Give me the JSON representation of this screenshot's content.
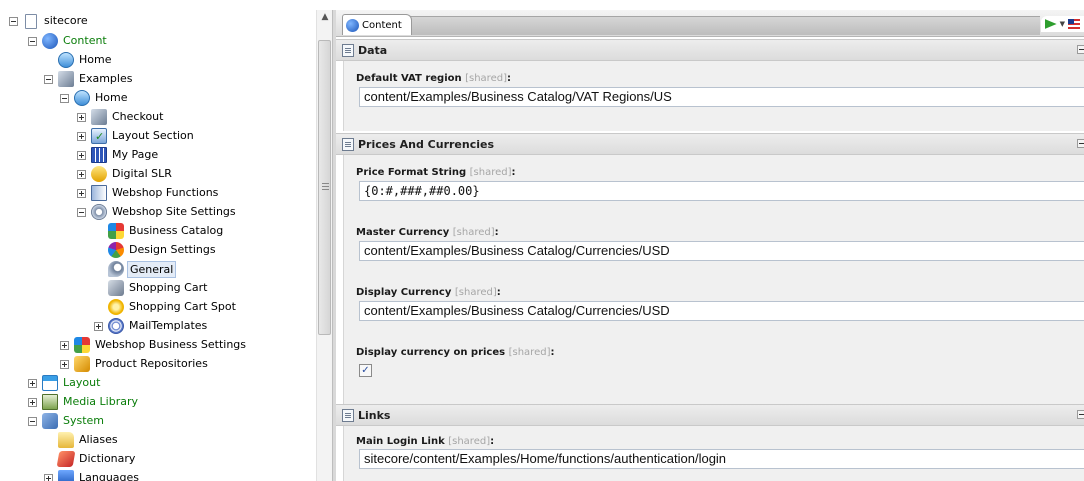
{
  "tree": {
    "items": [
      {
        "label": "sitecore",
        "toggle": "minus",
        "icon": "page-icon"
      },
      {
        "label": "Content",
        "toggle": "minus",
        "icon": "content-globe-icon"
      },
      {
        "label": "Home",
        "toggle": "none",
        "icon": "home-icon"
      },
      {
        "label": "Examples",
        "toggle": "minus",
        "icon": "examples-icon"
      },
      {
        "label": "Home",
        "toggle": "minus",
        "icon": "home-icon"
      },
      {
        "label": "Checkout",
        "toggle": "plus",
        "icon": "checkout-icon"
      },
      {
        "label": "Layout Section",
        "toggle": "plus",
        "icon": "layout-section-icon"
      },
      {
        "label": "My Page",
        "toggle": "plus",
        "icon": "my-page-icon"
      },
      {
        "label": "Digital SLR",
        "toggle": "plus",
        "icon": "camera-icon"
      },
      {
        "label": "Webshop Functions",
        "toggle": "plus",
        "icon": "webshop-functions-icon"
      },
      {
        "label": "Webshop Site Settings",
        "toggle": "minus",
        "icon": "settings-gear-icon"
      },
      {
        "label": "Business Catalog",
        "toggle": "none",
        "icon": "business-catalog-icon"
      },
      {
        "label": "Design Settings",
        "toggle": "none",
        "icon": "palette-icon"
      },
      {
        "label": "General",
        "toggle": "none",
        "icon": "wrench-icon"
      },
      {
        "label": "Shopping Cart",
        "toggle": "none",
        "icon": "shopping-cart-icon"
      },
      {
        "label": "Shopping Cart Spot",
        "toggle": "none",
        "icon": "cart-spot-icon"
      },
      {
        "label": "MailTemplates",
        "toggle": "plus",
        "icon": "mail-templates-icon"
      },
      {
        "label": "Webshop Business Settings",
        "toggle": "plus",
        "icon": "business-settings-icon"
      },
      {
        "label": "Product Repositories",
        "toggle": "plus",
        "icon": "product-repositories-icon"
      },
      {
        "label": "Layout",
        "toggle": "plus",
        "icon": "layout-icon"
      },
      {
        "label": "Media Library",
        "toggle": "plus",
        "icon": "media-library-icon"
      },
      {
        "label": "System",
        "toggle": "minus",
        "icon": "system-icon"
      },
      {
        "label": "Aliases",
        "toggle": "none",
        "icon": "aliases-icon"
      },
      {
        "label": "Dictionary",
        "toggle": "none",
        "icon": "dictionary-icon"
      },
      {
        "label": "Languages",
        "toggle": "plus",
        "icon": "languages-icon"
      }
    ],
    "selected": "General"
  },
  "tabs": {
    "active_label": "Content"
  },
  "sections": {
    "data": {
      "title": "Data",
      "fields": {
        "vat": {
          "label": "Default VAT region",
          "shared": "[shared]",
          "value": "content/Examples/Business Catalog/VAT Regions/US"
        }
      }
    },
    "prices": {
      "title": "Prices And Currencies",
      "fields": {
        "format": {
          "label": "Price Format String",
          "shared": "[shared]",
          "value": "{0:#,###,##0.00}"
        },
        "master": {
          "label": "Master Currency",
          "shared": "[shared]",
          "value": "content/Examples/Business Catalog/Currencies/USD"
        },
        "display": {
          "label": "Display Currency",
          "shared": "[shared]",
          "value": "content/Examples/Business Catalog/Currencies/USD"
        },
        "showcur": {
          "label": "Display currency on prices",
          "shared": "[shared]",
          "checked": true
        }
      }
    },
    "links": {
      "title": "Links",
      "fields": {
        "login": {
          "label": "Main Login Link",
          "shared": "[shared]",
          "value": "sitecore/content/Examples/Home/functions/authentication/login"
        }
      }
    }
  },
  "colors": {
    "tree_green": "#0a7d0a",
    "section_bg": "#e0e0e0",
    "field_bg": "#f0f0f0"
  }
}
